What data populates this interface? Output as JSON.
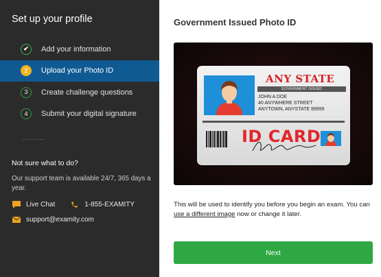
{
  "sidebar": {
    "title": "Set up your profile",
    "steps": [
      {
        "badge": "✔",
        "label": "Add your information"
      },
      {
        "badge": "2",
        "label": "Upload your Photo ID"
      },
      {
        "badge": "3",
        "label": "Create challenge questions"
      },
      {
        "badge": "4",
        "label": "Submit your digital signature"
      }
    ],
    "help": {
      "title": "Not sure what to do?",
      "text": "Our support team is available 24/7, 365 days a year.",
      "live_chat": "Live Chat",
      "phone": "1-855-EXAMITY",
      "email": "support@examity.com"
    }
  },
  "main": {
    "title": "Government Issued Photo ID",
    "id_card": {
      "state": "ANY STATE",
      "issuer": "GOVERNMENT ISSUED",
      "name": "JOHN A DOE",
      "street": "40 ANYWHERE STREET",
      "city": "ANYTOWN, ANYSTATE 99999",
      "label": "ID CARD"
    },
    "description_before": "This will be used to identify you before you begin an exam. You can ",
    "description_link": "use a different image",
    "description_after": " now or change it later.",
    "next_label": "Next"
  },
  "colors": {
    "sidebar_bg": "#2b2b2b",
    "active_step": "#0f5a93",
    "badge_ring": "#2ea043",
    "active_badge": "#f0b41e",
    "next_button": "#2ea843",
    "id_red": "#d62226"
  }
}
